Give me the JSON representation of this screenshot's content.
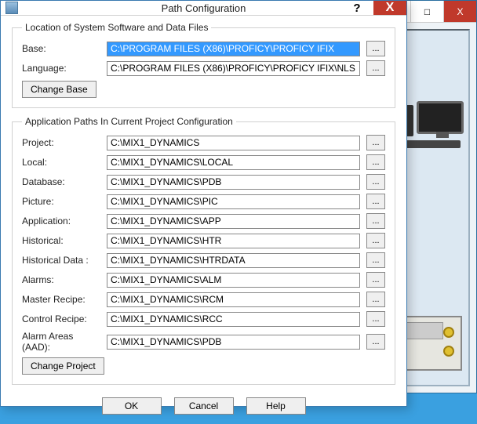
{
  "dialog": {
    "title": "Path Configuration",
    "help_glyph": "?",
    "close_glyph": "X"
  },
  "bg": {
    "min_glyph": "—",
    "max_glyph": "□",
    "close_glyph": "X"
  },
  "section1": {
    "legend": "Location of System Software and Data Files",
    "base_label": "Base:",
    "base_value": "C:\\PROGRAM FILES (X86)\\PROFICY\\PROFICY IFIX",
    "language_label": "Language:",
    "language_value": "C:\\PROGRAM FILES (X86)\\PROFICY\\PROFICY IFIX\\NLS",
    "change_base": "Change Base"
  },
  "section2": {
    "legend": "Application Paths In Current Project Configuration",
    "rows": [
      {
        "label": "Project:",
        "value": "C:\\MIX1_DYNAMICS"
      },
      {
        "label": "Local:",
        "value": "C:\\MIX1_DYNAMICS\\LOCAL"
      },
      {
        "label": "Database:",
        "value": "C:\\MIX1_DYNAMICS\\PDB"
      },
      {
        "label": "Picture:",
        "value": "C:\\MIX1_DYNAMICS\\PIC"
      },
      {
        "label": "Application:",
        "value": "C:\\MIX1_DYNAMICS\\APP"
      },
      {
        "label": "Historical:",
        "value": "C:\\MIX1_DYNAMICS\\HTR"
      },
      {
        "label": "Historical Data :",
        "value": "C:\\MIX1_DYNAMICS\\HTRDATA"
      },
      {
        "label": "Alarms:",
        "value": "C:\\MIX1_DYNAMICS\\ALM"
      },
      {
        "label": "Master Recipe:",
        "value": "C:\\MIX1_DYNAMICS\\RCM"
      },
      {
        "label": "Control Recipe:",
        "value": "C:\\MIX1_DYNAMICS\\RCC"
      },
      {
        "label": "Alarm Areas (AAD):",
        "value": "C:\\MIX1_DYNAMICS\\PDB"
      }
    ],
    "change_project": "Change Project"
  },
  "browse_label": "...",
  "footer": {
    "ok": "OK",
    "cancel": "Cancel",
    "help": "Help"
  }
}
